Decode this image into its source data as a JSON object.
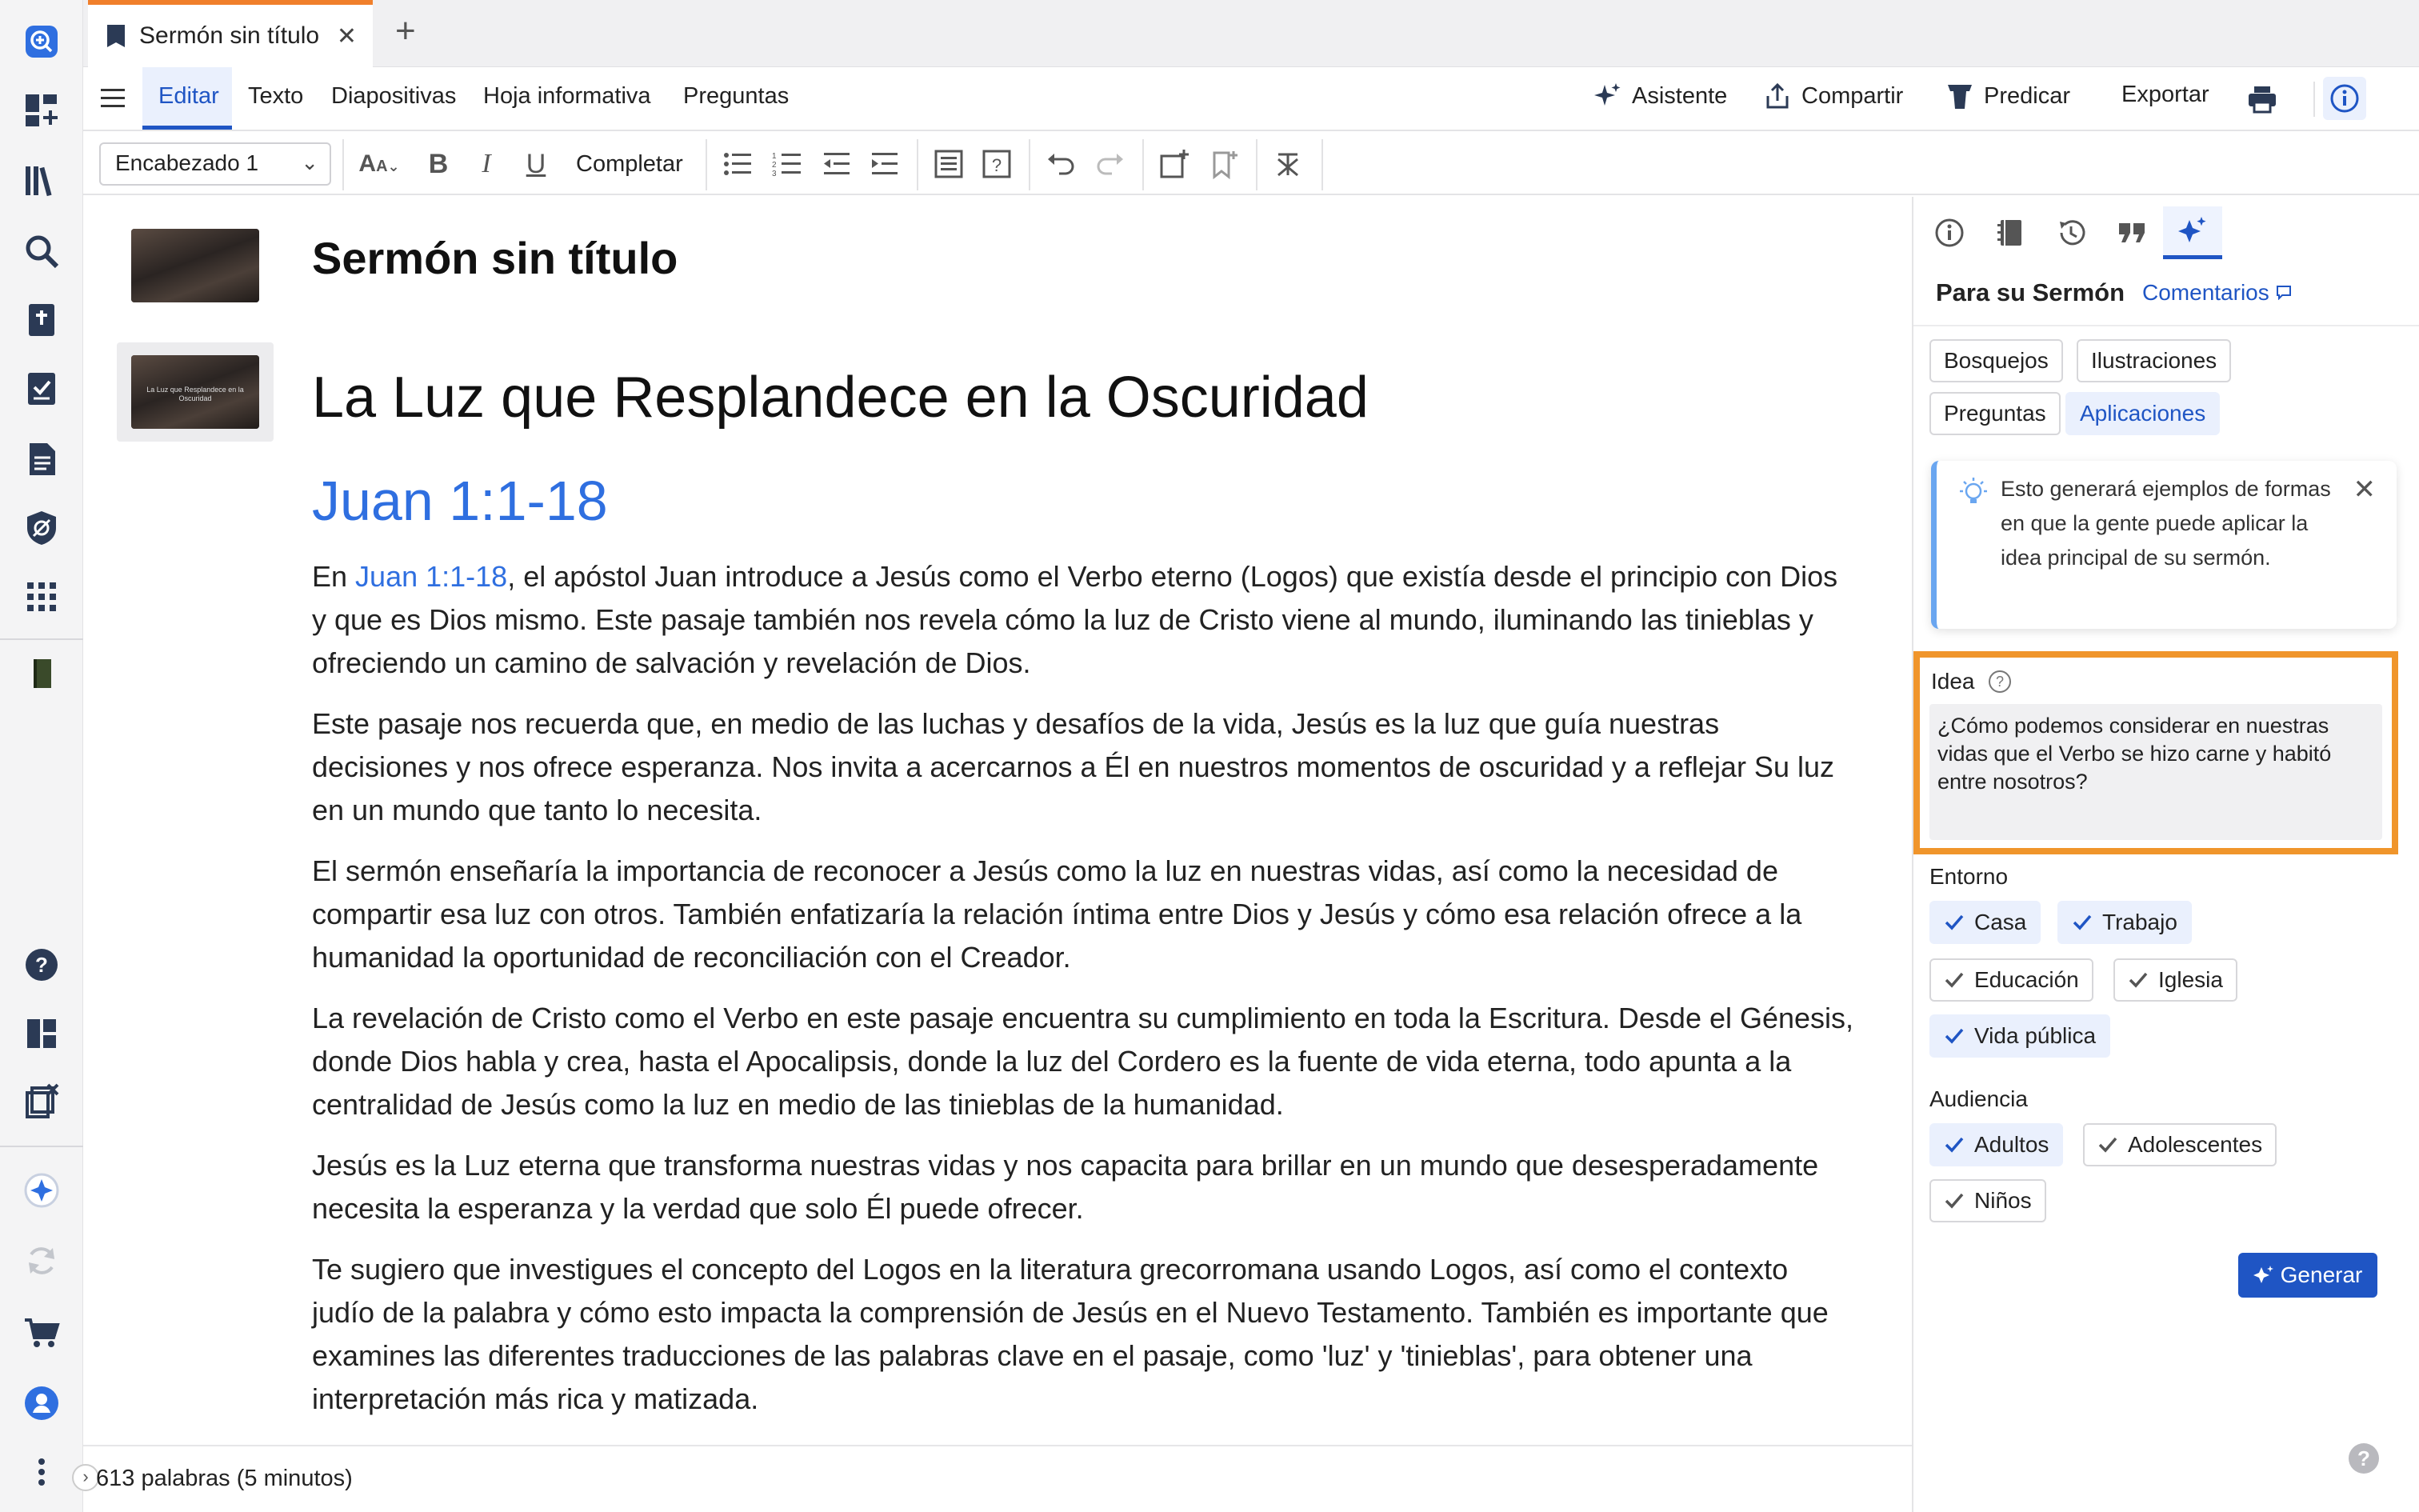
{
  "tabs": {
    "doc_title": "Sermón sin título"
  },
  "menu": {
    "items": [
      "Editar",
      "Texto",
      "Diapositivas",
      "Hoja informativa",
      "Preguntas"
    ],
    "right": {
      "assistant": "Asistente",
      "share": "Compartir",
      "preach": "Predicar",
      "export": "Exportar"
    }
  },
  "toolbar": {
    "style": "Encabezado 1",
    "complete": "Completar"
  },
  "document": {
    "title": "Sermón sin título",
    "sermon_heading": "La Luz que Resplandece en la Oscuridad",
    "thumbnail_text": "La Luz que Resplandece en la Oscuridad",
    "scripture_heading": "Juan 1:1-18",
    "p1_before": "En ",
    "p1_link": "Juan 1:1-18",
    "p1_after": ", el apóstol Juan introduce a Jesús como el Verbo eterno (Logos) que existía desde el principio con Dios y que es Dios mismo. Este pasaje también nos revela cómo la luz de Cristo viene al mundo, iluminando las tinieblas y ofreciendo un camino de salvación y revelación de Dios.",
    "p2": "Este pasaje nos recuerda que, en medio de las luchas y desafíos de la vida, Jesús es la luz que guía nuestras decisiones y nos ofrece esperanza. Nos invita a acercarnos a Él en nuestros momentos de oscuridad y a reflejar Su luz en un mundo que tanto lo necesita.",
    "p3": "El sermón enseñaría la importancia de reconocer a Jesús como la luz en nuestras vidas, así como la necesidad de compartir esa luz con otros. También enfatizaría la relación íntima entre Dios y Jesús y cómo esa relación ofrece a la humanidad la oportunidad de reconciliación con el Creador.",
    "p4": "La revelación de Cristo como el Verbo en este pasaje encuentra su cumplimiento en toda la Escritura. Desde el Génesis, donde Dios habla y crea, hasta el Apocalipsis, donde la luz del Cordero es la fuente de vida eterna, todo apunta a la centralidad de Jesús como la luz en medio de las tinieblas de la humanidad.",
    "p5": "Jesús es la Luz eterna que transforma nuestras vidas y nos capacita para brillar en un mundo que desesperadamente necesita la esperanza y la verdad que solo Él puede ofrecer.",
    "p6": "Te sugiero que investigues el concepto del Logos en la literatura grecorromana usando Logos, así como el contexto judío de la palabra y cómo esto impacta la comprensión de Jesús en el Nuevo Testamento. También es importante que examines las diferentes traducciones de las palabras clave en el pasaje, como 'luz' y 'tinieblas', para obtener una interpretación más rica y matizada."
  },
  "status": {
    "word_count": "613 palabras (5 minutos)"
  },
  "panel": {
    "heading": "Para su Sermón",
    "comments_link": "Comentarios",
    "chips": [
      "Bosquejos",
      "Ilustraciones",
      "Preguntas",
      "Aplicaciones"
    ],
    "info_text": "Esto generará ejemplos de formas en que la gente puede aplicar la idea principal de su sermón.",
    "idea_label": "Idea",
    "idea_value": "¿Cómo podemos considerar en nuestras vidas que el Verbo se hizo carne y habitó entre nosotros?",
    "setting_label": "Entorno",
    "settings": [
      "Casa",
      "Trabajo",
      "Educación",
      "Iglesia",
      "Vida pública"
    ],
    "audience_label": "Audiencia",
    "audiences": [
      "Adultos",
      "Adolescentes",
      "Niños"
    ],
    "generate": "Generar"
  },
  "colors": {
    "accent": "#1f55c4",
    "link": "#2f6fe0",
    "highlight": "#f0952b",
    "tab_accent": "#f07f2b"
  }
}
